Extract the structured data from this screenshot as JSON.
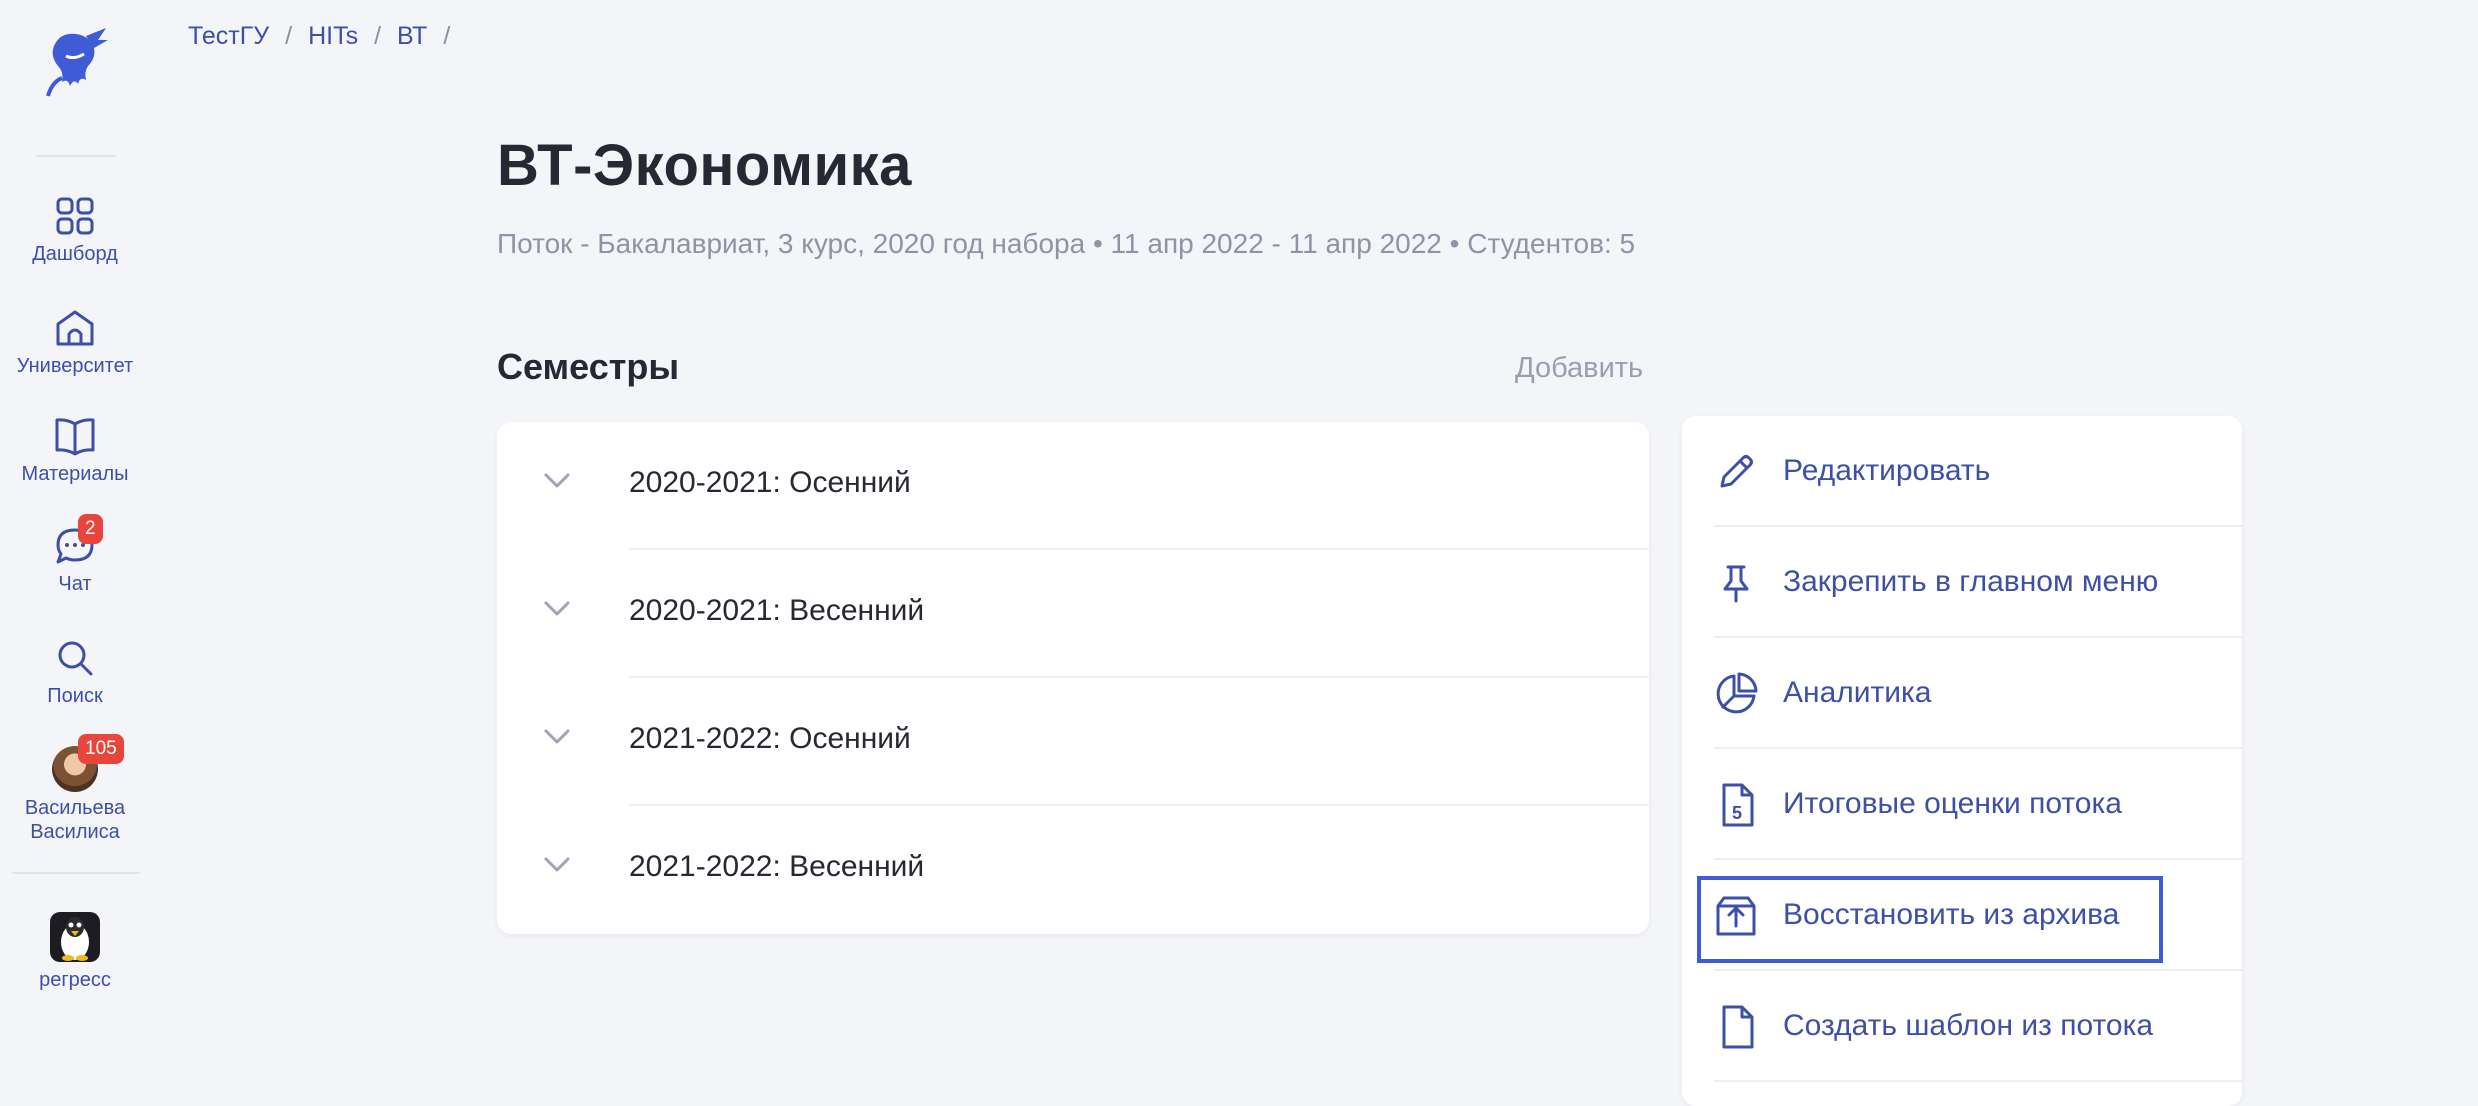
{
  "breadcrumb": [
    "ТестГУ",
    "HITs",
    "ВТ"
  ],
  "sidebar": {
    "items": [
      {
        "label": "Дашборд",
        "icon": "grid-icon"
      },
      {
        "label": "Университет",
        "icon": "university-icon"
      },
      {
        "label": "Материалы",
        "icon": "book-icon"
      },
      {
        "label": "Чат",
        "icon": "chat-icon",
        "badge": "2"
      },
      {
        "label": "Поиск",
        "icon": "search-icon"
      },
      {
        "label_line1": "Васильева",
        "label_line2": "Василиса",
        "icon": "avatar",
        "badge": "105"
      },
      {
        "label": "регресс",
        "icon": "penguin-app-icon"
      }
    ]
  },
  "page": {
    "title": "ВТ-Экономика",
    "subtitle": "Поток - Бакалавриат, 3 курс, 2020 год набора • 11 апр 2022 - 11 апр 2022 • Студентов: 5"
  },
  "semesters": {
    "title": "Семестры",
    "add_label": "Добавить",
    "items": [
      "2020-2021: Осенний",
      "2020-2021: Весенний",
      "2021-2022: Осенний",
      "2021-2022: Весенний"
    ]
  },
  "actions": {
    "items": [
      {
        "label": "Редактировать",
        "icon": "pencil-icon"
      },
      {
        "label": "Закрепить в главном меню",
        "icon": "pin-icon"
      },
      {
        "label": "Аналитика",
        "icon": "pie-chart-icon"
      },
      {
        "label": "Итоговые оценки потока",
        "icon": "grade-file-icon"
      },
      {
        "label": "Восстановить из архива",
        "icon": "unarchive-icon",
        "highlighted": true
      },
      {
        "label": "Создать шаблон из потока",
        "icon": "file-icon"
      }
    ]
  },
  "colors": {
    "accent": "#3d4fa6",
    "highlight": "#3f5bd6",
    "badge": "#e8453c",
    "background": "#f4f5f8"
  }
}
